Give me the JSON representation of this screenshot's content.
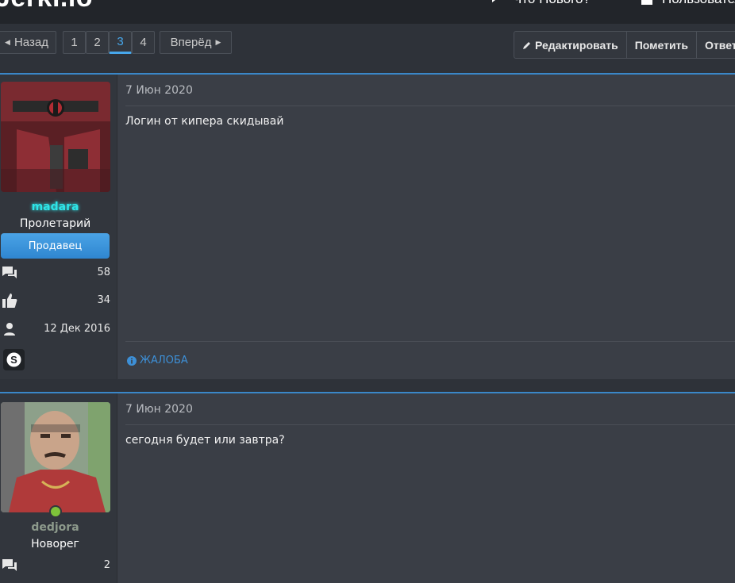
{
  "header": {
    "logo_text": "Jerki.io",
    "nav_whatsnew": "Что Нового?",
    "nav_users": "Пользователи"
  },
  "pagination": {
    "prev_label": "Назад",
    "next_label": "Вперёд",
    "pages": [
      "1",
      "2",
      "3",
      "4"
    ],
    "current_page": "3"
  },
  "actions": {
    "edit_label": "Редактировать",
    "mark_label": "Пометить",
    "reply_label": "Ответ"
  },
  "posts": [
    {
      "username": "madara",
      "username_color": "#2ee5e8",
      "user_title": "Пролетарий",
      "badge": "Продавец",
      "messages": "58",
      "reactions": "34",
      "joined": "12 Дек 2016",
      "has_skype": true,
      "date": "7 Июн 2020",
      "text": "Логин от кипера скидывай",
      "report_label": "ЖАЛОБА"
    },
    {
      "username": "dedjora",
      "username_color": "#8d9a8c",
      "user_title": "Новорег",
      "messages": "2",
      "online": true,
      "date": "7 Июн 2020",
      "text": "сегодня будет или завтра?"
    }
  ],
  "colors": {
    "accent": "#47a7eb",
    "badge_blue": "#3a94dc",
    "online_green": "#7ec23a"
  }
}
